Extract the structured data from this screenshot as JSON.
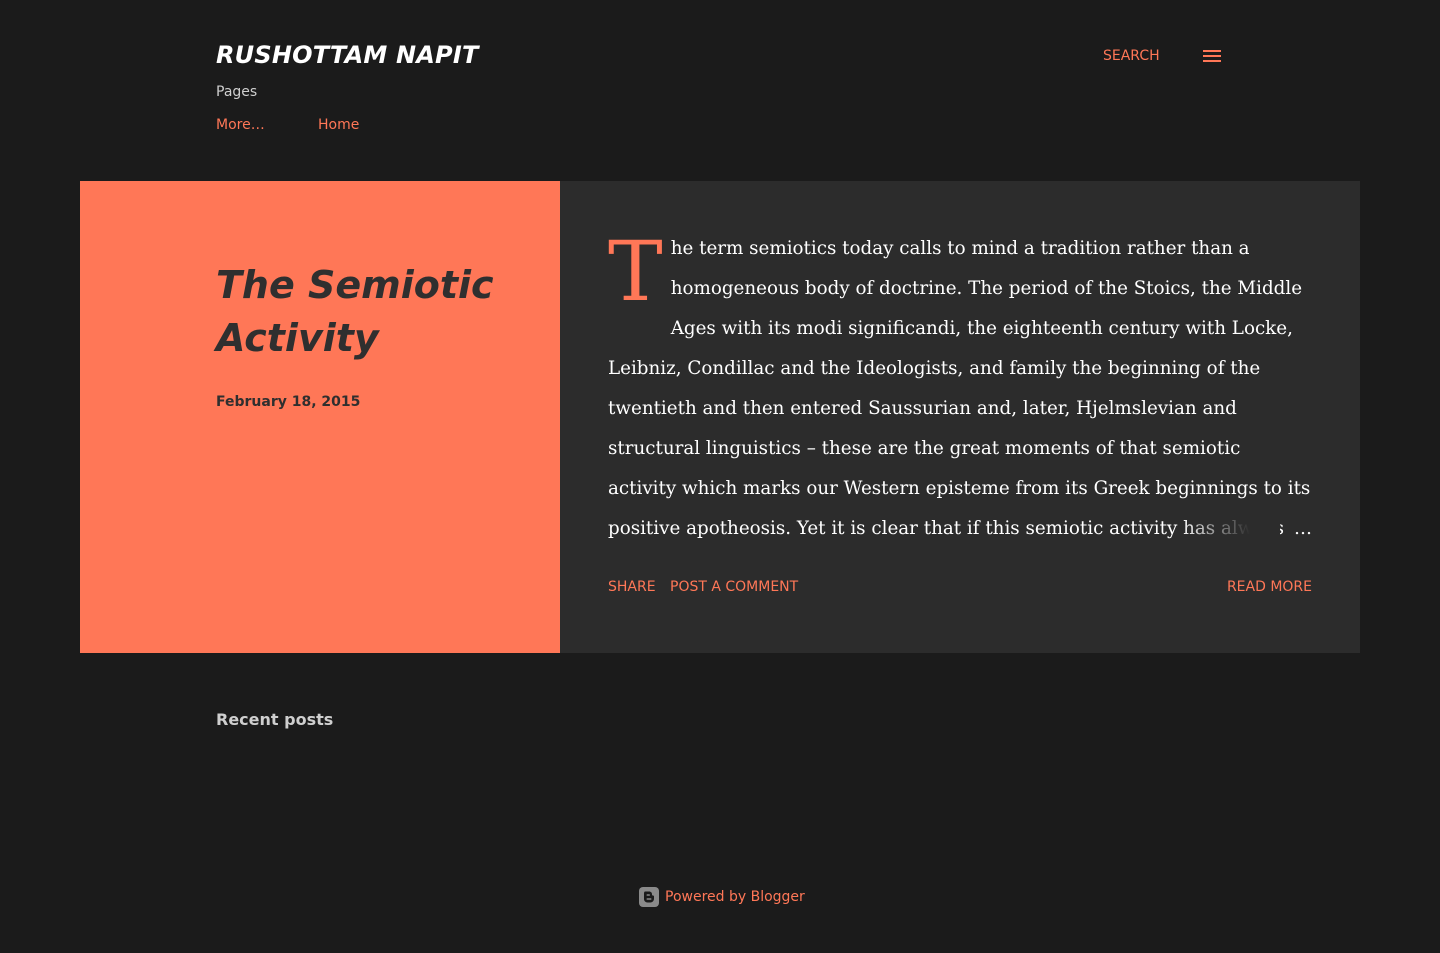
{
  "header": {
    "site_title": "Rushottam Napit",
    "search_label": "Search",
    "menu_icon": "hamburger-menu-icon"
  },
  "nav": {
    "pages_label": "Pages",
    "more_label": "More…",
    "home_label": "Home"
  },
  "post": {
    "title": "The Semiotic Activity",
    "date": "February 18, 2015",
    "drop_cap": "T",
    "snippet": "he term semiotics today calls to mind a tradition rather than a homogeneous body of doctrine. The period of the Stoics, the Middle Ages with its modi significandi, the eighteenth century with Locke, Leibniz, Condillac and the Ideologists, and family the beginning of the twentieth and then entered Saussurian and, later, Hjelmslevian and structural linguistics – these are the great moments of that semiotic activity which marks our Western episteme from its Greek beginnings to its positive apotheosis. Yet it is clear that if this semiotic activity has always been",
    "ellipsis": "…",
    "share_label": "Share",
    "comment_label": "Post a Comment",
    "read_more_label": "Read more"
  },
  "sidebar": {
    "recent_posts_label": "Recent posts"
  },
  "footer": {
    "powered_label": "Powered by Blogger",
    "icon": "blogger-icon"
  },
  "colors": {
    "background": "#1b1b1b",
    "accent": "#ff7757",
    "card_dark": "#2c2c2c",
    "title_dark": "#2f2f2f"
  }
}
